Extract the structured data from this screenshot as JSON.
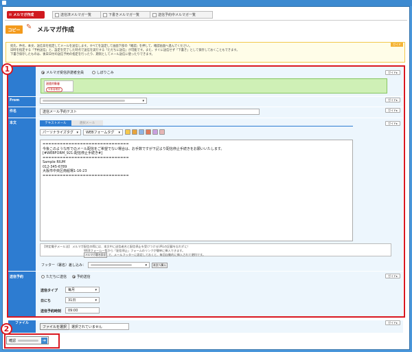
{
  "app": {
    "title": "メルマガ作成"
  },
  "toolbar": {
    "create_label": "メルマガ作成",
    "tabs": [
      "送信済メルマガ一覧",
      "下書きメルマガ一覧",
      "送信予約中メルマガ一覧"
    ]
  },
  "copy_label": "コピー",
  "notice": {
    "guide": "ガイド",
    "lines": [
      "宛先、件名、本文、送信日を指定してメールを送信します。すべてを設定して画面下部の「確認」を押して、確認画面へ進んでください。",
      "日時を指定する「予約送信」と、設定を完了した時点で送信を実行する「ただちに送信」が可能です。また、すぐに送信せず「下書き」として保存しておくこともできます。",
      "下書き保存したものは、後日日付の送信予約の指定を行ったり、期刻としてメール送信に使ったりできます。"
    ]
  },
  "form": {
    "guide_label": "ガイド",
    "to": {
      "opt1": "メルマガ受信許諾者全員",
      "opt2": "しぼりこみ",
      "box_title": "送信対象者",
      "box_btn": "対象者確認"
    },
    "from_label": "From",
    "subject_label": "件名",
    "subject_value": "送信メール予約テスト",
    "body_label": "本文",
    "body_tabs": [
      "テキストメール",
      "選択メール"
    ],
    "personalize": "パーソナライズタグ",
    "webform": "WEBフォームタグ",
    "body_lines": [
      "==============================",
      "今後このような形でのメール配信をご希望でない場合は、お手数ですが下記より配信停止手続きをお願いいたします。",
      "[#WEBFORM_921:配信停止手続き#]",
      "==============================",
      "Sample RIUM",
      "012-345-6789",
      "大阪市中央区南船場1-16-23",
      "=============================="
    ],
    "note_lines": [
      "【特定電子メール法】 メルマガ配信の際には、本文中に送信者名と配信停止を受けつけるURLの記載を忘れずに！",
      "WEBフォーム一覧から「配信停止」フォームのリンクが簡単に挿入できます。",
      "で、メールフッターに設定しておくと、毎回自動的に挿入されて便利です。"
    ],
    "note_btn": "メルマガ署名設定",
    "footer_label": "フッター（署名）差し込み：",
    "footer_btn": "本文へ挿入",
    "sched_label": "送信予約",
    "sched_opt1": "ただちに送信",
    "sched_opt2": "予約送信",
    "type_label": "送信タイプ",
    "type_value": "毎月",
    "day_label": "日にち",
    "day_value": "31日",
    "time_label": "送信予約時刻",
    "time_value": "09:00"
  },
  "file": {
    "label": "ファイル",
    "button": "ファイルを選択",
    "status": "選択されていません"
  },
  "confirm_label": "確認",
  "markers": {
    "one": "1",
    "two": "2"
  }
}
